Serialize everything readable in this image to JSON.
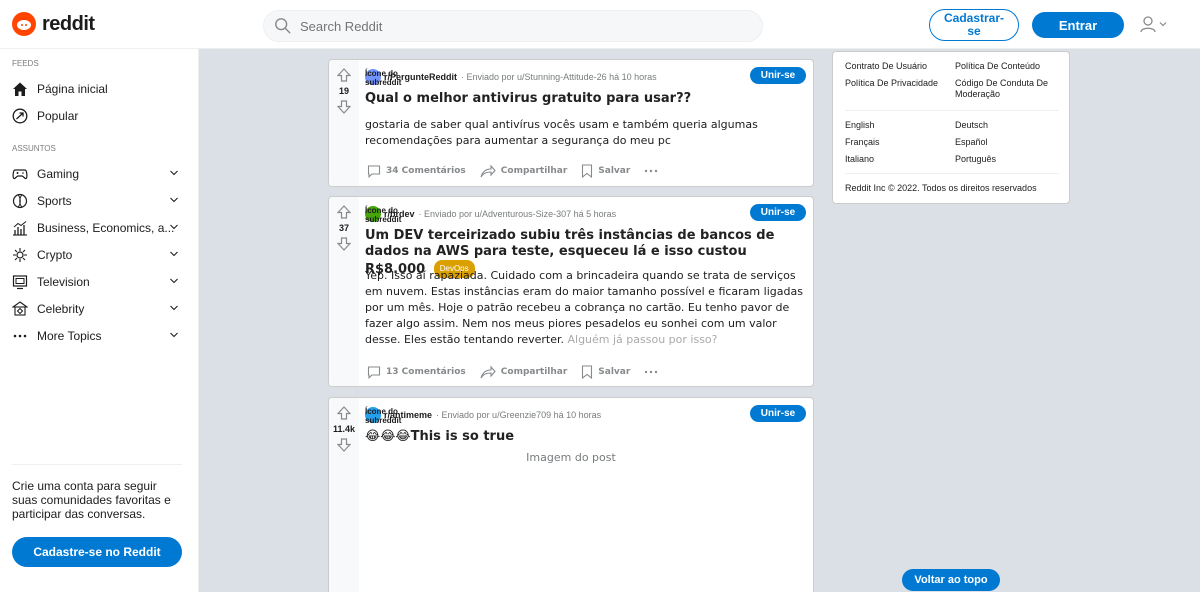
{
  "header": {
    "logo_text": "reddit",
    "search_placeholder": "Search Reddit",
    "signup_label": "Cadastrar-se",
    "login_label": "Entrar"
  },
  "sidebar": {
    "feeds_label": "FEEDS",
    "feeds": [
      {
        "label": "Página inicial",
        "icon": "home-icon"
      },
      {
        "label": "Popular",
        "icon": "popular-icon"
      }
    ],
    "topics_label": "ASSUNTOS",
    "topics": [
      {
        "label": "Gaming",
        "icon": "gamepad-icon"
      },
      {
        "label": "Sports",
        "icon": "sports-icon"
      },
      {
        "label": "Business, Economics, a...",
        "icon": "chart-icon"
      },
      {
        "label": "Crypto",
        "icon": "crypto-icon"
      },
      {
        "label": "Television",
        "icon": "tv-icon"
      },
      {
        "label": "Celebrity",
        "icon": "celebrity-icon"
      },
      {
        "label": "More Topics",
        "icon": "more-icon"
      }
    ],
    "cta_text": "Crie uma conta para seguir suas comunidades favoritas e participar das conversas.",
    "cta_button": "Cadastre-se no Reddit"
  },
  "posts": [
    {
      "icon_label": "Ícone do subreddit",
      "subreddit": "r/PergunteReddit",
      "meta": "· Enviado por  u/Stunning-Attitude-26 há 10 horas",
      "score": "19",
      "join_label": "Unir-se",
      "title": "Qual o melhor antivirus gratuito para usar??",
      "body": "gostaria de saber qual antivírus vocês usam e também queria algumas recomendações para aumentar a segurança do meu pc",
      "comments": "34 Comentários",
      "share": "Compartilhar",
      "save": "Salvar",
      "icon_color": "#7193ff"
    },
    {
      "icon_label": "Ícone do subreddit",
      "subreddit": "r/brdev",
      "meta": "· Enviado por  u/Adventurous-Size-307 há 5 horas",
      "score": "37",
      "join_label": "Unir-se",
      "title": "Um DEV terceirizado subiu três instâncias de bancos de dados na AWS para teste, esqueceu lá e isso custou R$8.000",
      "flair": "DevOps",
      "body": "Yep. Isso aí rapaziada. Cuidado com a brincadeira quando se trata de serviços em nuvem. Estas instâncias eram do maior tamanho possível e ficaram ligadas por um mês. Hoje o patrão recebeu a cobrança no cartão. Eu tenho pavor de fazer algo assim. Nem nos meus piores pesadelos eu sonhei com um valor desse. Eles estão tentando reverter.",
      "body_fade": "Alguém já passou por isso?",
      "comments": "13 Comentários",
      "share": "Compartilhar",
      "save": "Salvar",
      "icon_color": "#46a508"
    },
    {
      "icon_label": "Ícone do subreddit",
      "subreddit": "r/antimeme",
      "meta": "· Enviado por  u/Greenzie709 há 10 horas",
      "score": "11.4k",
      "join_label": "Unir-se",
      "title": "😂😂😂This is so true",
      "image_label": "Imagem do post",
      "icon_color": "#24a0ed"
    }
  ],
  "footer": {
    "links_col1": [
      "Contrato De Usuário",
      "Política De Privacidade"
    ],
    "links_col2": [
      "Política De Conteúdo",
      "Código De Conduta De Moderação"
    ],
    "langs_col1": [
      "English",
      "Français",
      "Italiano"
    ],
    "langs_col2": [
      "Deutsch",
      "Español",
      "Português"
    ],
    "copyright": "Reddit Inc © 2022. Todos os direitos reservados"
  },
  "back_to_top": "Voltar ao topo",
  "colors": {
    "accent": "#0079d3",
    "brand": "#ff4500",
    "flair": "#dba000"
  }
}
